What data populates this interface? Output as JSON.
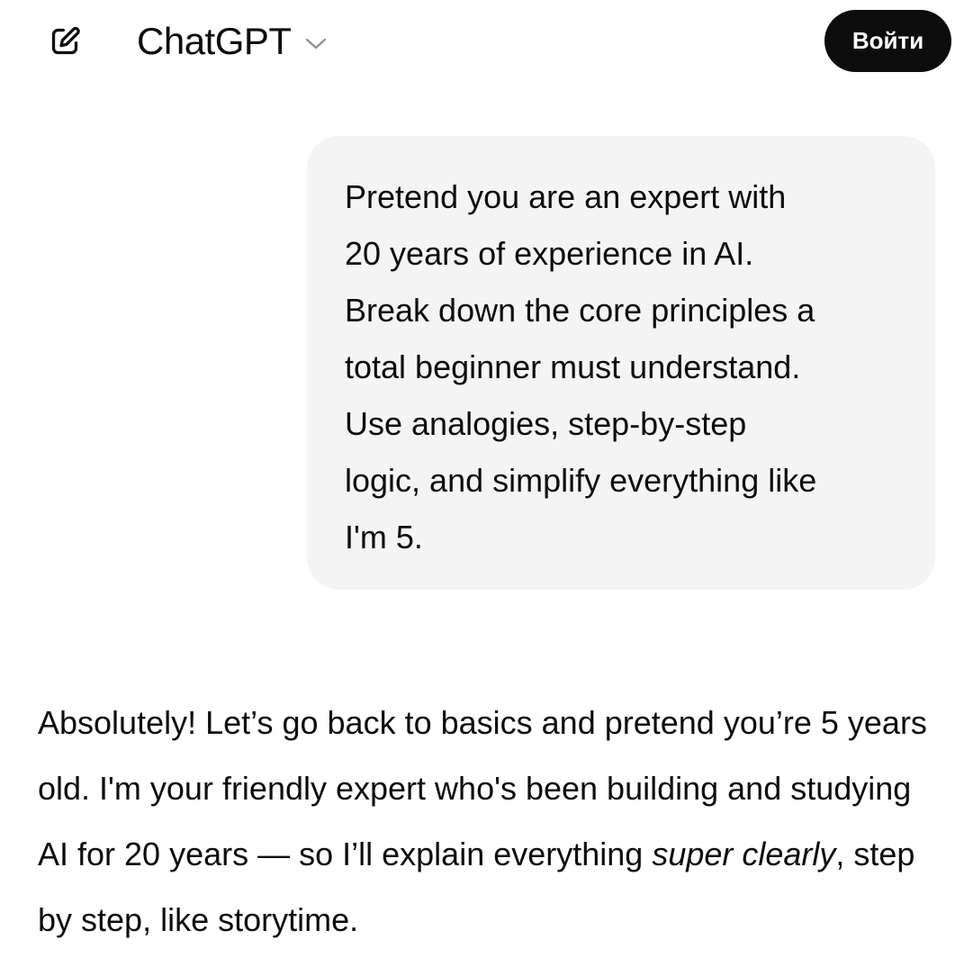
{
  "header": {
    "new_chat_icon": "compose-icon",
    "model_name": "ChatGPT",
    "chevron_icon": "chevron-down-icon",
    "login_label": "Войти"
  },
  "conversation": {
    "user_message": "Pretend you are an expert with\n20 years of experience in AI.\nBreak down the core principles a\ntotal beginner must understand.\nUse analogies, step-by-step\nlogic, and simplify everything like\nI'm 5.",
    "assistant_message": {
      "part1": "Absolutely! Let’s go back to basics and pretend you’re 5 years old. I'm your friendly expert who's been building and studying AI for 20 years — so I’ll explain everything ",
      "emphasis": "super clearly",
      "part2": ", step by step, like storytime."
    }
  },
  "colors": {
    "background": "#ffffff",
    "bubble": "#f4f4f4",
    "text": "#0d0d0d",
    "login_button": "#0d0d0d"
  }
}
